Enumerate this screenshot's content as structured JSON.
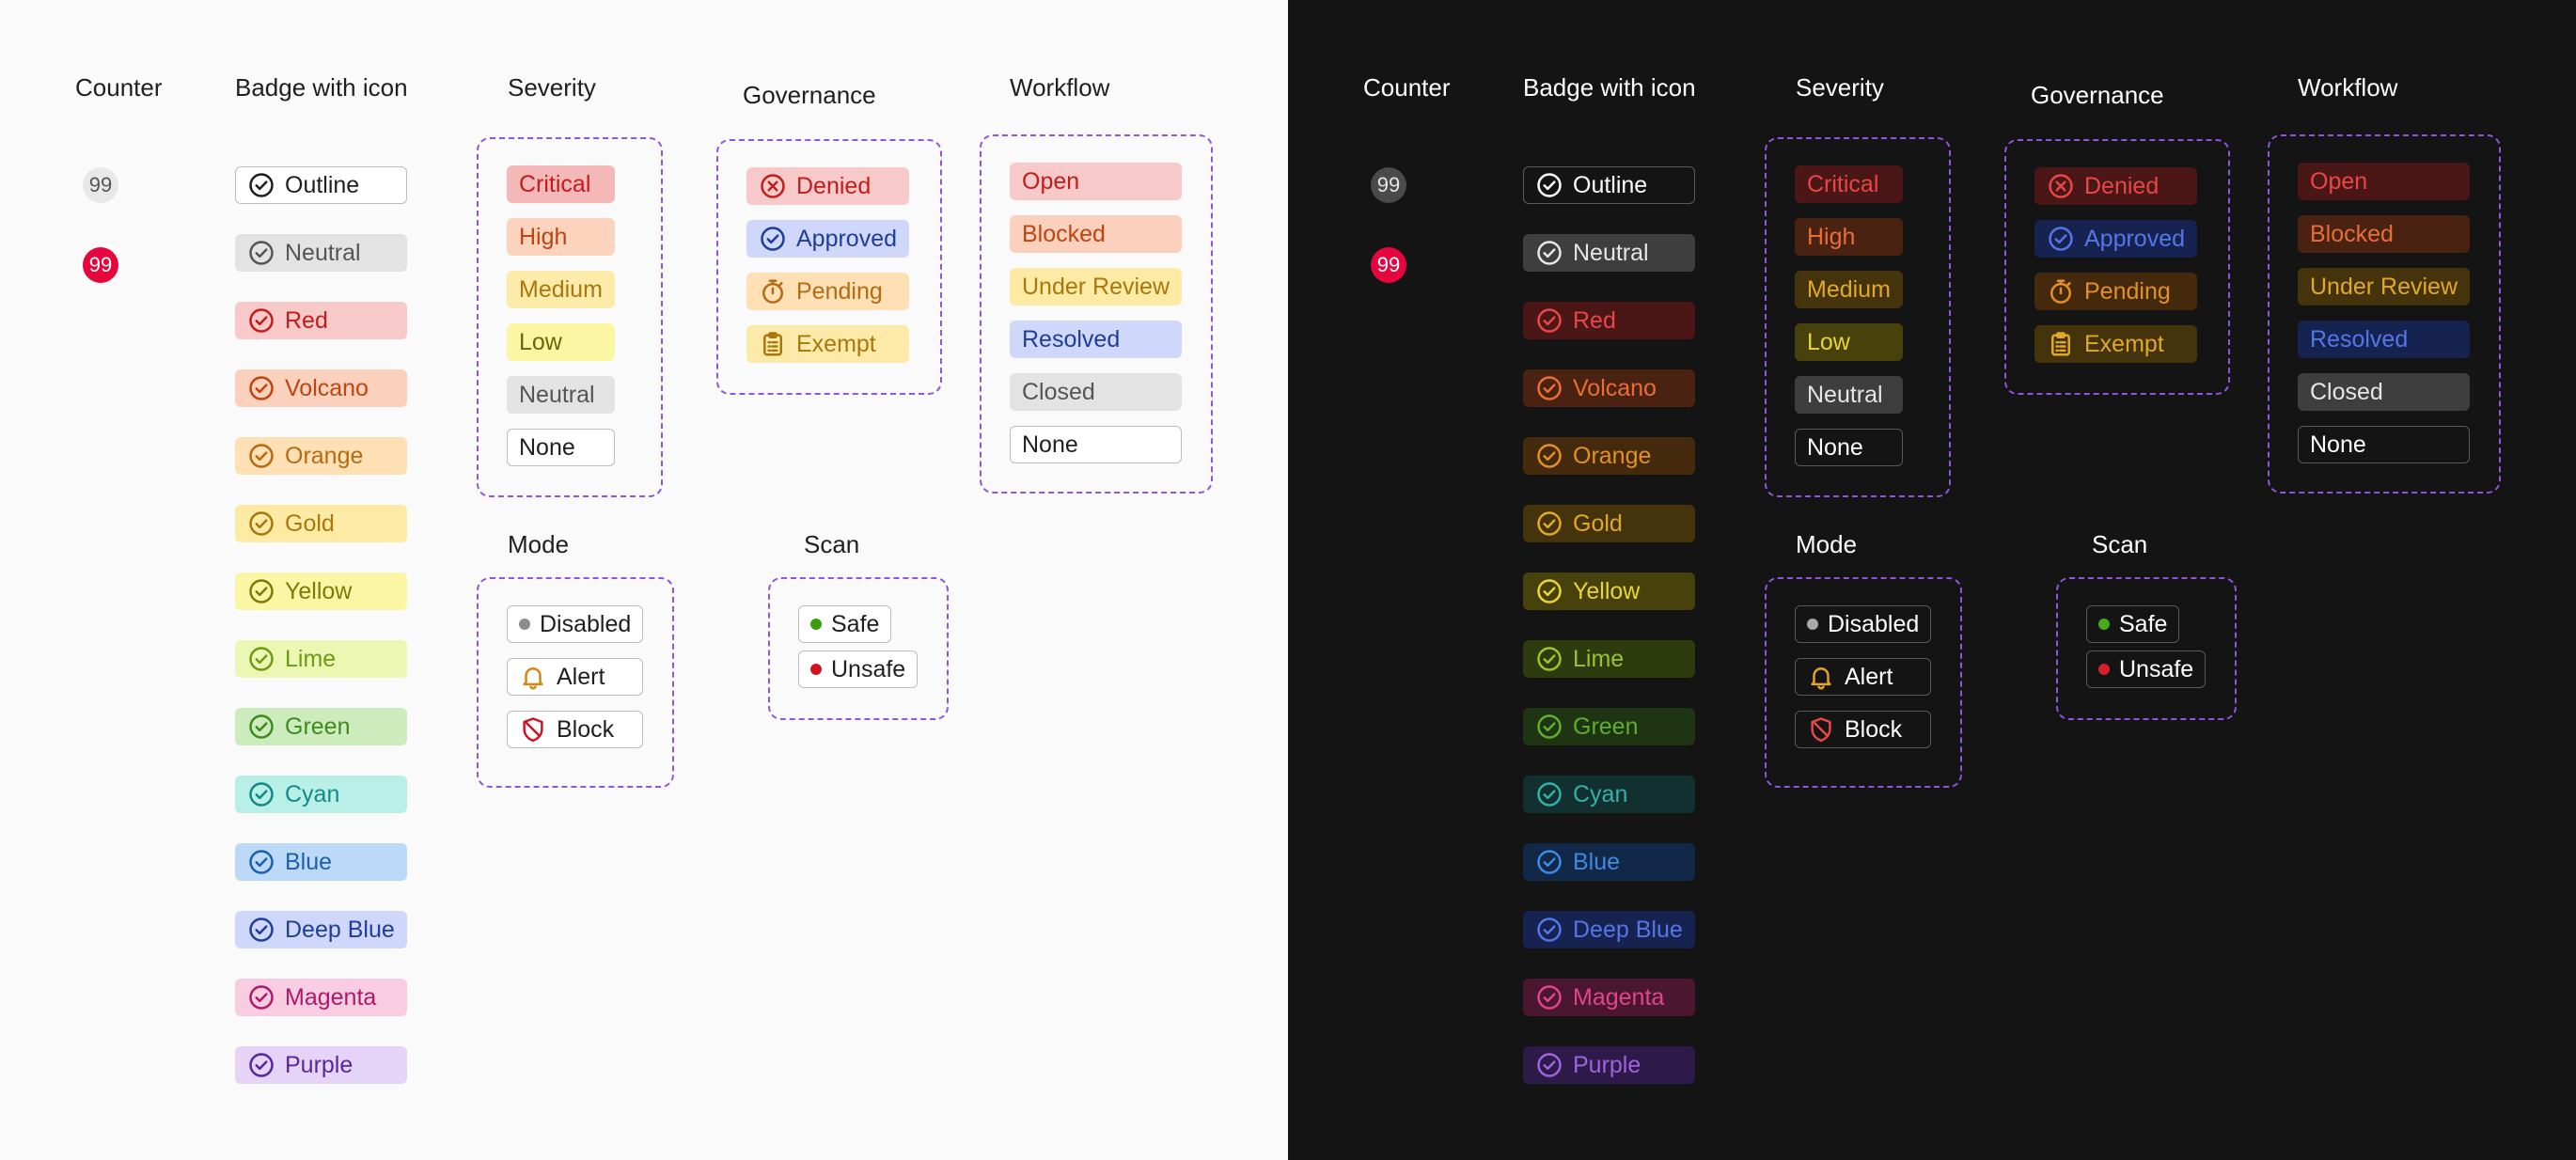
{
  "titles": {
    "counter": "Counter",
    "badge_icon": "Badge with icon",
    "severity": "Severity",
    "governance": "Governance",
    "workflow": "Workflow",
    "mode": "Mode",
    "scan": "Scan"
  },
  "counters": [
    "99",
    "99"
  ],
  "badges_with_icon": [
    "Outline",
    "Neutral",
    "Red",
    "Volcano",
    "Orange",
    "Gold",
    "Yellow",
    "Lime",
    "Green",
    "Cyan",
    "Blue",
    "Deep Blue",
    "Magenta",
    "Purple"
  ],
  "severity": [
    "Critical",
    "High",
    "Medium",
    "Low",
    "Neutral",
    "None"
  ],
  "governance": [
    "Denied",
    "Approved",
    "Pending",
    "Exempt"
  ],
  "workflow": [
    "Open",
    "Blocked",
    "Under Review",
    "Resolved",
    "Closed",
    "None"
  ],
  "mode": [
    "Disabled",
    "Alert",
    "Block"
  ],
  "scan": [
    "Safe",
    "Unsafe"
  ],
  "icons": {
    "badge": "check-circle-icon",
    "denied": "x-circle-icon",
    "approved": "check-circle-icon",
    "pending": "stopwatch-icon",
    "exempt": "clipboard-icon",
    "disabled": "status-dot-icon",
    "alert": "bell-icon",
    "block": "shield-slash-icon",
    "scan": "status-dot-icon"
  },
  "colors": {
    "accent_dashed_border": "#9254de",
    "counter_red": "#e6063d",
    "safe": "#389e0d",
    "unsafe": "#cf1322",
    "alert_icon": "#d4880f",
    "block_icon": "#cf1322"
  }
}
